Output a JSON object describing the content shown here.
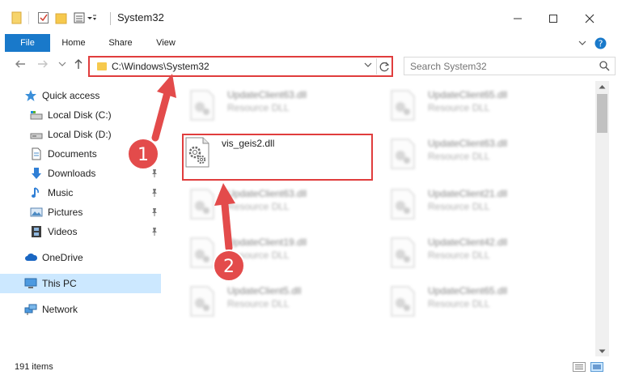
{
  "window": {
    "title": "System32"
  },
  "ribbon": {
    "tabs": [
      "File",
      "Home",
      "Share",
      "View"
    ]
  },
  "address": {
    "path": "C:\\Windows\\System32",
    "search_placeholder": "Search System32"
  },
  "nav": {
    "items": [
      {
        "label": "Quick access",
        "icon": "star-icon",
        "pinned": false
      },
      {
        "label": "Local Disk (C:)",
        "icon": "drive-icon",
        "pinned": false
      },
      {
        "label": "Local Disk (D:)",
        "icon": "drive-icon",
        "pinned": false
      },
      {
        "label": "Documents",
        "icon": "document-icon",
        "pinned": true
      },
      {
        "label": "Downloads",
        "icon": "download-arrow-icon",
        "pinned": true
      },
      {
        "label": "Music",
        "icon": "music-note-icon",
        "pinned": true
      },
      {
        "label": "Pictures",
        "icon": "picture-icon",
        "pinned": true
      },
      {
        "label": "Videos",
        "icon": "film-icon",
        "pinned": true
      },
      {
        "label": "OneDrive",
        "icon": "cloud-icon",
        "pinned": false
      },
      {
        "label": "This PC",
        "icon": "monitor-icon",
        "pinned": false,
        "selected": true
      },
      {
        "label": "Network",
        "icon": "network-icon",
        "pinned": false
      }
    ]
  },
  "files": [
    {
      "name": "UpdateClient63.dll",
      "type": "Resource DLL",
      "blurred": true
    },
    {
      "name": "UpdateClient65.dll",
      "type": "Resource DLL",
      "blurred": true
    },
    {
      "name": "vis_geis2.dll",
      "type": "",
      "blurred": false,
      "highlighted": true
    },
    {
      "name": "UpdateClient63.dll",
      "type": "Resource DLL",
      "blurred": true
    },
    {
      "name": "UpdateClient63.dll",
      "type": "Resource DLL",
      "blurred": true
    },
    {
      "name": "UpdateClient21.dll",
      "type": "Resource DLL",
      "blurred": true
    },
    {
      "name": "UpdateClient19.dll",
      "type": "Resource DLL",
      "blurred": true
    },
    {
      "name": "UpdateClient42.dll",
      "type": "Resource DLL",
      "blurred": true
    },
    {
      "name": "UpdateClient5.dll",
      "type": "Resource DLL",
      "blurred": true
    },
    {
      "name": "UpdateClient65.dll",
      "type": "Resource DLL",
      "blurred": true
    }
  ],
  "status": {
    "item_count": "191 items"
  },
  "annotations": {
    "step1": "1",
    "step2": "2",
    "accent_color": "#e03d3d"
  }
}
